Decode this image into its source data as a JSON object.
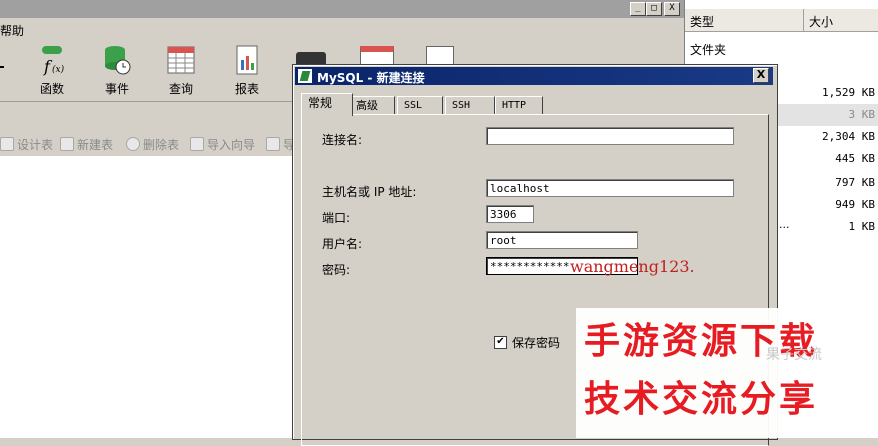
{
  "main_window": {
    "menu_help": "帮助",
    "window_buttons": [
      "_",
      "□",
      "X"
    ],
    "toolbar": [
      {
        "label": "函数",
        "icon": "function-icon"
      },
      {
        "label": "事件",
        "icon": "event-icon"
      },
      {
        "label": "查询",
        "icon": "query-icon"
      },
      {
        "label": "报表",
        "icon": "report-icon"
      }
    ],
    "small_toolbar": [
      "设计表",
      "新建表",
      "删除表",
      "导入向导",
      "导"
    ]
  },
  "file_pane": {
    "col_type": "类型",
    "col_size": "大小",
    "folder_label": "文件夹",
    "sizes": [
      "1,529 KB",
      "3 KB",
      "2,304 KB",
      "445 KB",
      "797 KB",
      "949 KB",
      "1 KB"
    ],
    "dots": "..."
  },
  "dialog": {
    "title": "MySQL - 新建连接",
    "close": "X",
    "tabs": [
      "常规",
      "高级",
      "SSL",
      "SSH",
      "HTTP"
    ],
    "fields": {
      "conn_name_label": "连接名:",
      "conn_name_value": "",
      "host_label": "主机名或 IP 地址:",
      "host_value": "localhost",
      "port_label": "端口:",
      "port_value": "3306",
      "user_label": "用户名:",
      "user_value": "root",
      "password_label": "密码:",
      "password_value": "************",
      "save_password_label": "保存密码",
      "save_password_checked": true
    },
    "annotation": "wangmeng123."
  },
  "watermark": {
    "line1": "手游资源下载",
    "line2": "技术交流分享",
    "faint": "果子交流"
  }
}
